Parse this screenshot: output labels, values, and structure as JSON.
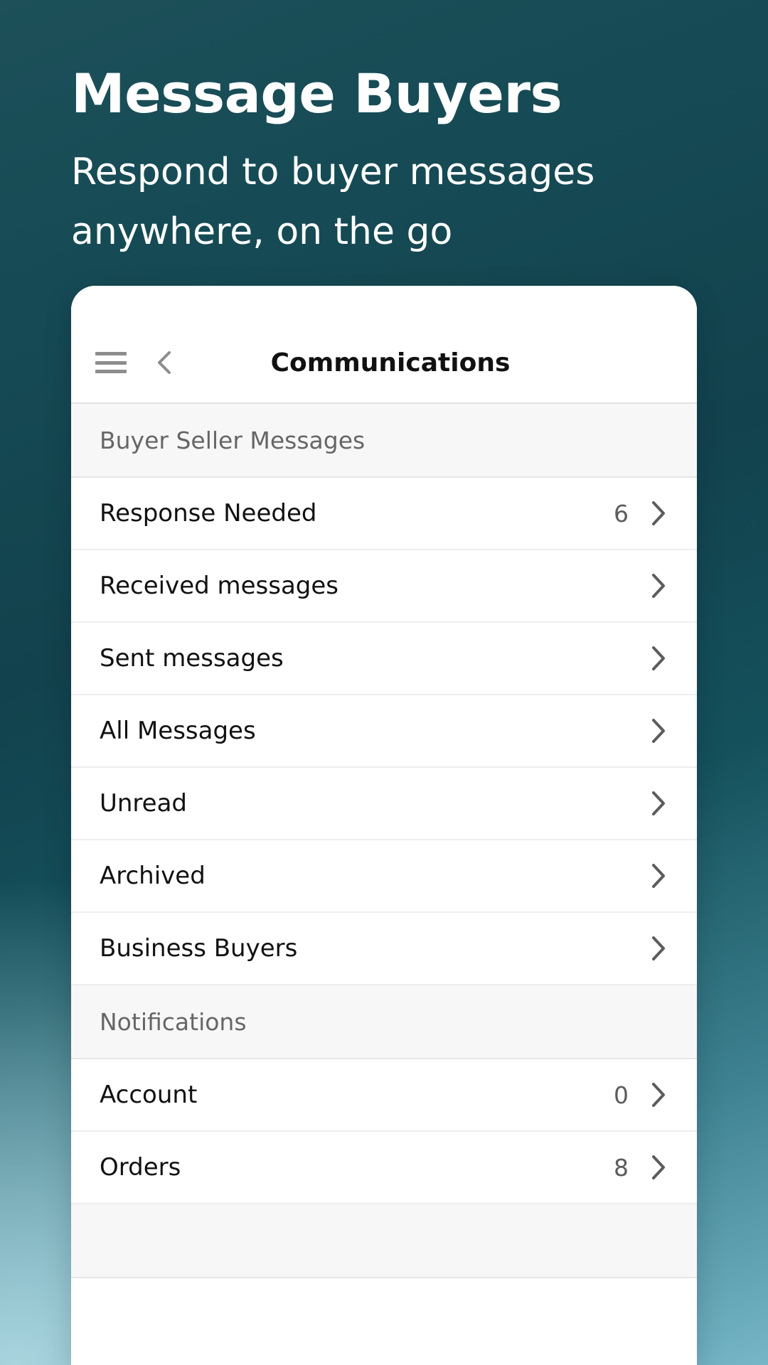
{
  "hero": {
    "title": "Message Buyers",
    "subtitle": "Respond to buyer messages anywhere, on the go"
  },
  "appbar": {
    "title": "Communications",
    "menu_icon": "hamburger-menu-icon",
    "back_icon": "chevron-left-icon"
  },
  "colors": {
    "background_top": "#15454f",
    "background_bottom": "#9fd0dc",
    "card": "#ffffff",
    "section_header_bg": "#f7f7f7",
    "row_label": "#111111",
    "row_count": "#5c5c5c",
    "divider": "#eeeeee"
  },
  "sections": [
    {
      "header": "Buyer Seller Messages",
      "rows": [
        {
          "label": "Response Needed",
          "count": "6",
          "chevron": "chevron-right-icon"
        },
        {
          "label": "Received messages",
          "count": "",
          "chevron": "chevron-right-icon"
        },
        {
          "label": "Sent messages",
          "count": "",
          "chevron": "chevron-right-icon"
        },
        {
          "label": "All Messages",
          "count": "",
          "chevron": "chevron-right-icon"
        },
        {
          "label": "Unread",
          "count": "",
          "chevron": "chevron-right-icon"
        },
        {
          "label": "Archived",
          "count": "",
          "chevron": "chevron-right-icon"
        },
        {
          "label": "Business Buyers",
          "count": "",
          "chevron": "chevron-right-icon"
        }
      ]
    },
    {
      "header": "Notifications",
      "rows": [
        {
          "label": "Account",
          "count": "0",
          "chevron": "chevron-right-icon"
        },
        {
          "label": "Orders",
          "count": "8",
          "chevron": "chevron-right-icon"
        }
      ]
    }
  ]
}
